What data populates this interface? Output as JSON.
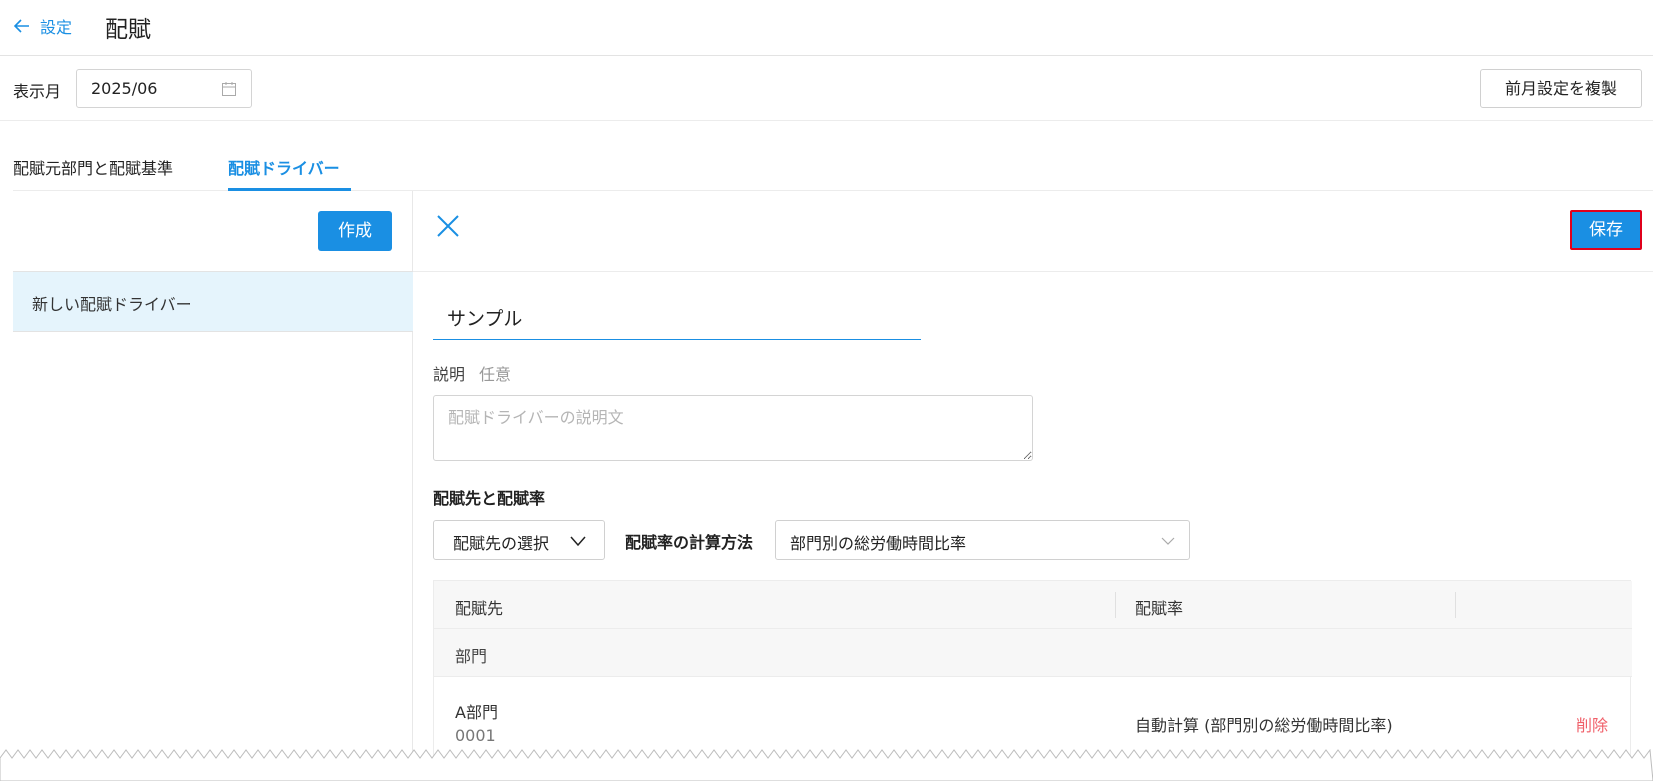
{
  "header": {
    "back_label": "設定",
    "title": "配賦"
  },
  "month": {
    "label": "表示月",
    "value": "2025/06",
    "copy_button": "前月設定を複製"
  },
  "tabs": [
    {
      "label": "配賦元部門と配賦基準",
      "active": false
    },
    {
      "label": "配賦ドライバー",
      "active": true
    }
  ],
  "sidebar": {
    "create_button": "作成",
    "items": [
      {
        "label": "新しい配賦ドライバー",
        "selected": true
      }
    ]
  },
  "editor": {
    "save_button": "保存",
    "name_value": "サンプル",
    "description": {
      "label": "説明",
      "optional": "任意",
      "placeholder": "配賦ドライバーの説明文"
    },
    "section_title": "配賦先と配賦率",
    "dest_select_label": "配賦先の選択",
    "calc_method_label": "配賦率の計算方法",
    "calc_method_value": "部門別の総労働時間比率",
    "table": {
      "headers": {
        "destination": "配賦先",
        "rate": "配賦率"
      },
      "group_label": "部門",
      "rows": [
        {
          "name": "A部門",
          "code": "0001",
          "rate": "自動計算 (部門別の総労働時間比率)",
          "delete": "削除"
        }
      ]
    }
  },
  "colors": {
    "accent": "#1a8fe3",
    "highlight": "#e0001b",
    "delete": "#f0606a",
    "selected_bg": "#e5f4fc"
  }
}
